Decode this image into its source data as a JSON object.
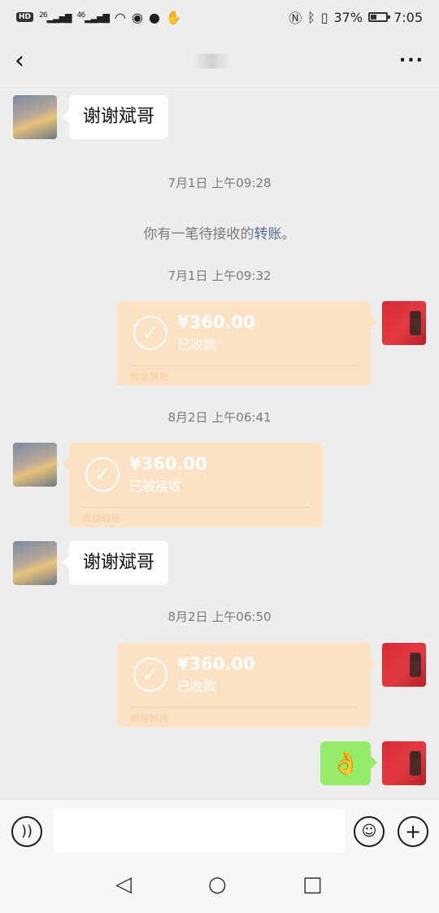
{
  "status_bar": {
    "hd": "HD",
    "signal1": "26",
    "signal2": "46",
    "battery_pct": "37%",
    "battery_level": 0.37,
    "time": "7:05"
  },
  "header": {
    "back_icon": "back-arrow-icon",
    "contact_name": "",
    "more_icon": "more-icon"
  },
  "messages": {
    "msg1": "谢谢斌哥",
    "ts1": "7月1日 上午09:28",
    "sys_prefix": "你有一笔待接收的",
    "sys_link": "转账",
    "sys_suffix": "。",
    "ts2": "7月1日 上午09:32",
    "transfer1": {
      "amount": "¥360.00",
      "status": "已收款",
      "footer": "微信转账"
    },
    "ts3": "8月2日 上午06:41",
    "transfer2": {
      "amount": "¥360.00",
      "status": "已被接收",
      "footer": "微信转账"
    },
    "msg2": "谢谢斌哥",
    "ts4": "8月2日 上午06:50",
    "transfer3": {
      "amount": "¥360.00",
      "status": "已收款",
      "footer": "微信转账"
    },
    "emoji": "👌"
  },
  "input_bar": {
    "voice_icon": "voice-icon",
    "emoji_icon": "emoji-icon",
    "plus_icon": "plus-icon",
    "placeholder": ""
  },
  "nav": {
    "back_icon": "nav-back-icon",
    "home_icon": "nav-home-icon",
    "recent_icon": "nav-recent-icon"
  },
  "colors": {
    "background": "#ededed",
    "transfer_bg": "#fce2c4",
    "sent_bubble": "#95ec69",
    "link": "#576b95"
  }
}
